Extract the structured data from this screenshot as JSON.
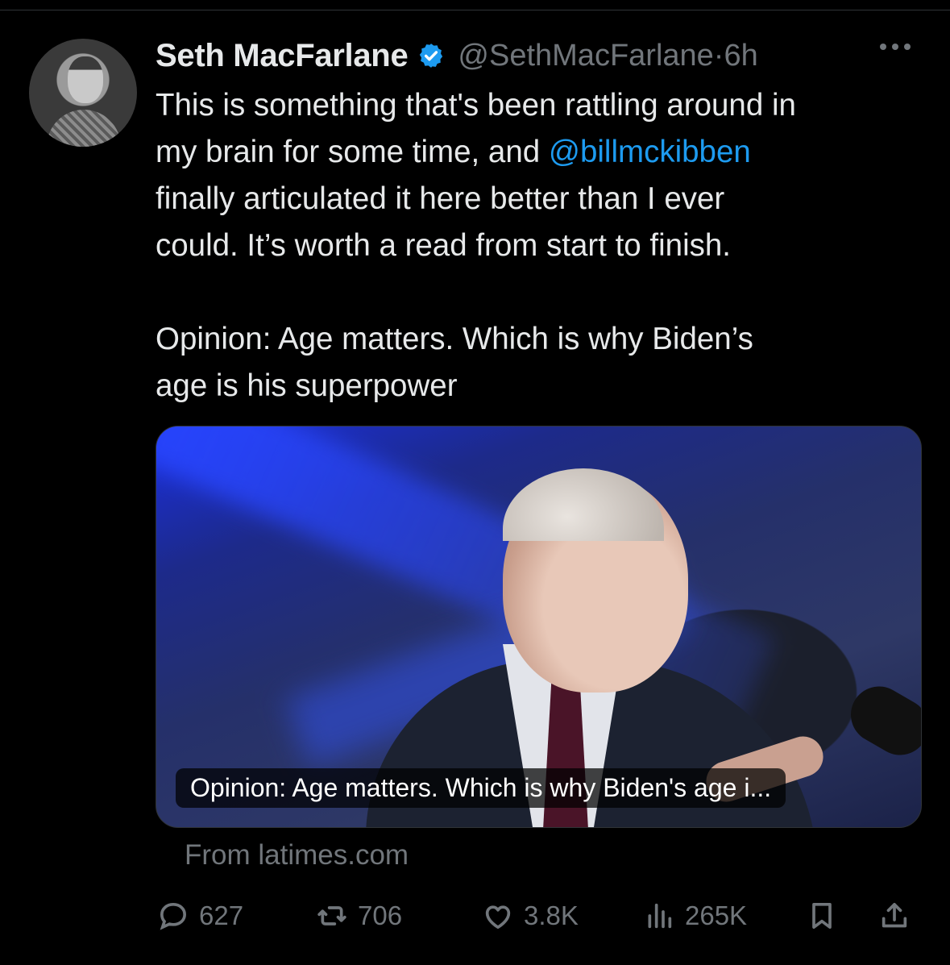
{
  "tweet": {
    "author_name": "Seth MacFarlane",
    "handle_time": "@SethMacFarlane·6h",
    "body_lines": [
      "This is something that's been rattling around in",
      "my brain for some time, and ",
      "@billmckibben",
      "finally articulated it here better than I ever",
      "could. It’s worth a read from start to finish."
    ],
    "headline_lines": [
      "Opinion: Age matters. Which is why Biden’s",
      "age is his superpower"
    ]
  },
  "card": {
    "caption": "Opinion: Age matters. Which is why Biden's age i...",
    "source": "From latimes.com"
  },
  "actions": {
    "replies": "627",
    "reposts": "706",
    "likes": "3.8K",
    "views": "265K"
  },
  "colors": {
    "background": "#000000",
    "text": "#e7e9ea",
    "secondary": "#71767b",
    "link": "#1d9bf0",
    "verified": "#1d9bf0"
  },
  "icons": [
    "verified-badge-icon",
    "more-options-icon",
    "reply-icon",
    "repost-icon",
    "like-icon",
    "views-icon",
    "bookmark-icon",
    "share-icon"
  ]
}
